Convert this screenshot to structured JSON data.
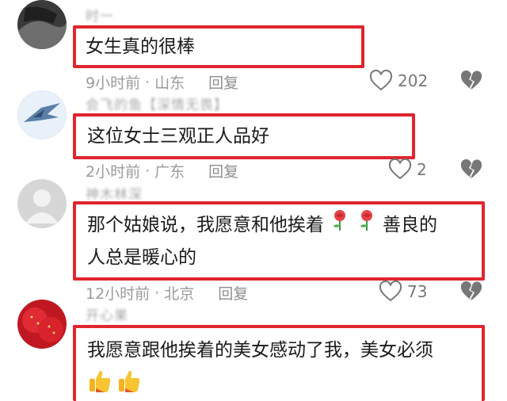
{
  "comments": [
    {
      "username": "时一",
      "text": "女生真的很棒",
      "time": "9小时前",
      "location": "山东",
      "reply_label": "回复",
      "likes": "202"
    },
    {
      "username": "会飞的鱼【深情无畏】",
      "text": "这位女士三观正人品好",
      "time": "2小时前",
      "location": "广东",
      "reply_label": "回复",
      "likes": "2"
    },
    {
      "username": "神木林深",
      "text_line1_part1": "那个姑娘说，我愿意和他挨着",
      "text_line1_part2": "善良的",
      "text_line2": "人总是暖心的",
      "time": "12小时前",
      "location": "北京",
      "reply_label": "回复",
      "likes": "73"
    },
    {
      "username": "开心果",
      "text": "我愿意跟他挨着的美女感动了我，美女必须",
      "time": "",
      "location": ""
    }
  ],
  "meta_separator": "·",
  "icons": {
    "like": "heart-outline-icon",
    "dislike": "broken-heart-icon",
    "rose": "rose-emoji",
    "thumbs_up": "thumbs-up-emoji"
  },
  "colors": {
    "highlight_border": "#e0252e",
    "meta_text": "#9a9a9a",
    "icon_gray": "#777777"
  }
}
